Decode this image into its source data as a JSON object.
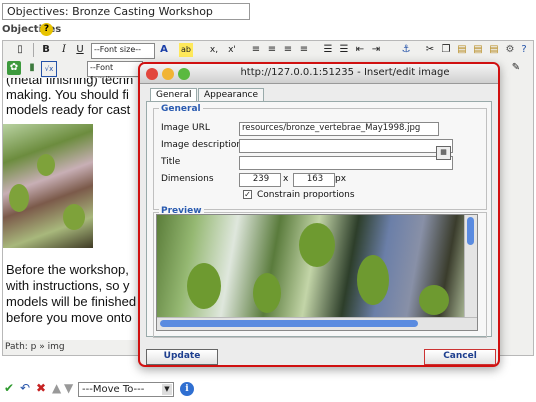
{
  "title_field": {
    "value": "Objectives: Bronze Casting Workshop"
  },
  "objectives_label": "Objectives",
  "help_glyph": "?",
  "toolbar": {
    "font_size_placeholder": "--Font size--",
    "font_family_placeholder": "--Font family--",
    "bold": "B",
    "italic": "I",
    "underline": "U",
    "text_color": "A",
    "highlight": "ab",
    "subscript": "x,",
    "superscript": "x'"
  },
  "editor_text": {
    "line1": "(metal finishing) techn",
    "line2": "making. You should fi",
    "line3": "models ready for cast",
    "line4": "Before the workshop,",
    "line5": "with instructions, so y",
    "line6": "models will be finished",
    "line7": "before you move onto"
  },
  "path_bar": {
    "text": "Path: p » img"
  },
  "bottom_bar": {
    "move_to": "---Move To---"
  },
  "dialog": {
    "title": "http://127.0.0.1:51235 - Insert/edit image",
    "tabs": [
      {
        "label": "General"
      },
      {
        "label": "Appearance"
      }
    ],
    "general_legend": "General",
    "fields": {
      "image_url_label": "Image URL",
      "image_url_value": "resources/bronze_vertebrae_May1998.jpg",
      "image_description_label": "Image description",
      "image_description_value": "",
      "title_label": "Title",
      "title_value": "",
      "dimensions_label": "Dimensions",
      "width_value": "239",
      "dimension_separator": "x",
      "height_value": "163",
      "unit": "px",
      "constrain_label": "Constrain proportions",
      "constrain_checked": true
    },
    "preview_legend": "Preview",
    "update_label": "Update",
    "cancel_label": "Cancel"
  },
  "colors": {
    "dialog_border": "#d01010",
    "legend": "#2a5bb0",
    "scroll_thumb": "#5a8be0",
    "close_dot": "#e2463c",
    "minimize_dot": "#f1b433",
    "zoom_dot": "#5ab940"
  }
}
